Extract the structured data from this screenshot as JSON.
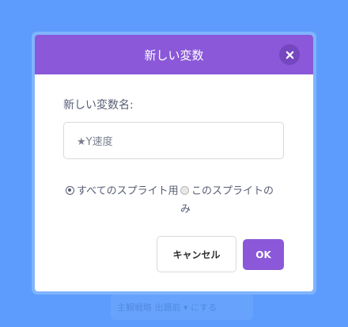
{
  "background_ui": {
    "ghost_text": "主観戦略 出題前 ▾ にする"
  },
  "dialog": {
    "title": "新しい変数",
    "close_icon": "close-icon",
    "field_label": "新しい変数名:",
    "name_input": {
      "value": "★Y速度",
      "placeholder": ""
    },
    "radio_options": [
      {
        "label": "すべてのスプライト用",
        "selected": true
      },
      {
        "label": "このスプライトのみ",
        "selected": false
      }
    ],
    "cancel_label": "キャンセル",
    "ok_label": "OK"
  },
  "colors": {
    "background": "#5d9cfc",
    "header": "#8a58d8",
    "accent": "#8a58d8",
    "text": "#575e75"
  }
}
